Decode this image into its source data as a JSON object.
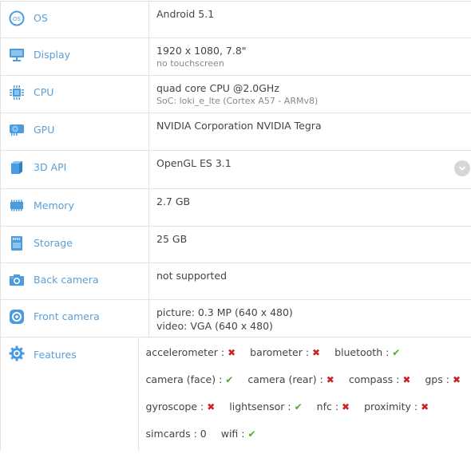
{
  "rows": [
    {
      "key": "os",
      "icon": "os-icon",
      "label": "OS",
      "value": "Android 5.1",
      "sub": ""
    },
    {
      "key": "display",
      "icon": "monitor-icon",
      "label": "Display",
      "value": "1920 x 1080, 7.8\"",
      "sub": "no touchscreen"
    },
    {
      "key": "cpu",
      "icon": "cpu-chip-icon",
      "label": "CPU",
      "value": "quad core CPU @2.0GHz",
      "sub": "SoC: loki_e_lte (Cortex A57 - ARMv8)"
    },
    {
      "key": "gpu",
      "icon": "graphics-card-icon",
      "label": "GPU",
      "value": "NVIDIA Corporation NVIDIA Tegra",
      "sub": ""
    },
    {
      "key": "3d-api",
      "icon": "cube-icon",
      "label": "3D API",
      "value": "OpenGL ES 3.1",
      "sub": "",
      "expand_icon": "chevron-down-icon"
    },
    {
      "key": "memory",
      "icon": "memory-module-icon",
      "label": "Memory",
      "value": "2.7 GB",
      "sub": ""
    },
    {
      "key": "storage",
      "icon": "sd-card-icon",
      "label": "Storage",
      "value": "25 GB",
      "sub": ""
    },
    {
      "key": "back-camera",
      "icon": "camera-icon",
      "label": "Back camera",
      "value": "not supported",
      "sub": ""
    },
    {
      "key": "front-camera",
      "icon": "front-camera-icon",
      "label": "Front camera",
      "value": "picture: 0.3 MP (640 x 480)",
      "sub": "video: VGA (640 x 480)"
    }
  ],
  "features": {
    "icon": "gear-icon",
    "label": "Features",
    "lines": [
      [
        {
          "name": "accelerometer",
          "sep": " : ",
          "status": "no",
          "mark": "✖"
        },
        {
          "name": "barometer",
          "sep": " : ",
          "status": "no",
          "mark": "✖"
        },
        {
          "name": "bluetooth",
          "sep": " : ",
          "status": "yes",
          "mark": "✔"
        }
      ],
      [
        {
          "name": "camera (face)",
          "sep": " : ",
          "status": "yes",
          "mark": "✔"
        },
        {
          "name": "camera (rear)",
          "sep": " : ",
          "status": "no",
          "mark": "✖"
        },
        {
          "name": "compass",
          "sep": " : ",
          "status": "no",
          "mark": "✖"
        },
        {
          "name": "gps",
          "sep": " : ",
          "status": "no",
          "mark": "✖"
        }
      ],
      [
        {
          "name": "gyroscope",
          "sep": " : ",
          "status": "no",
          "mark": "✖"
        },
        {
          "name": "lightsensor",
          "sep": " : ",
          "status": "yes",
          "mark": "✔"
        },
        {
          "name": "nfc",
          "sep": " : ",
          "status": "no",
          "mark": "✖"
        },
        {
          "name": "proximity",
          "sep": " : ",
          "status": "no",
          "mark": "✖"
        }
      ],
      [
        {
          "name": "simcards",
          "sep": " : ",
          "status": "value",
          "mark": "0"
        },
        {
          "name": "wifi",
          "sep": " : ",
          "status": "yes",
          "mark": "✔"
        }
      ]
    ]
  },
  "colors": {
    "label_blue": "#5a9fd6",
    "icon_blue": "#4a9be0",
    "yes_green": "#4caa2c",
    "no_red": "#cc2222",
    "grid": "#e3e3e3"
  }
}
